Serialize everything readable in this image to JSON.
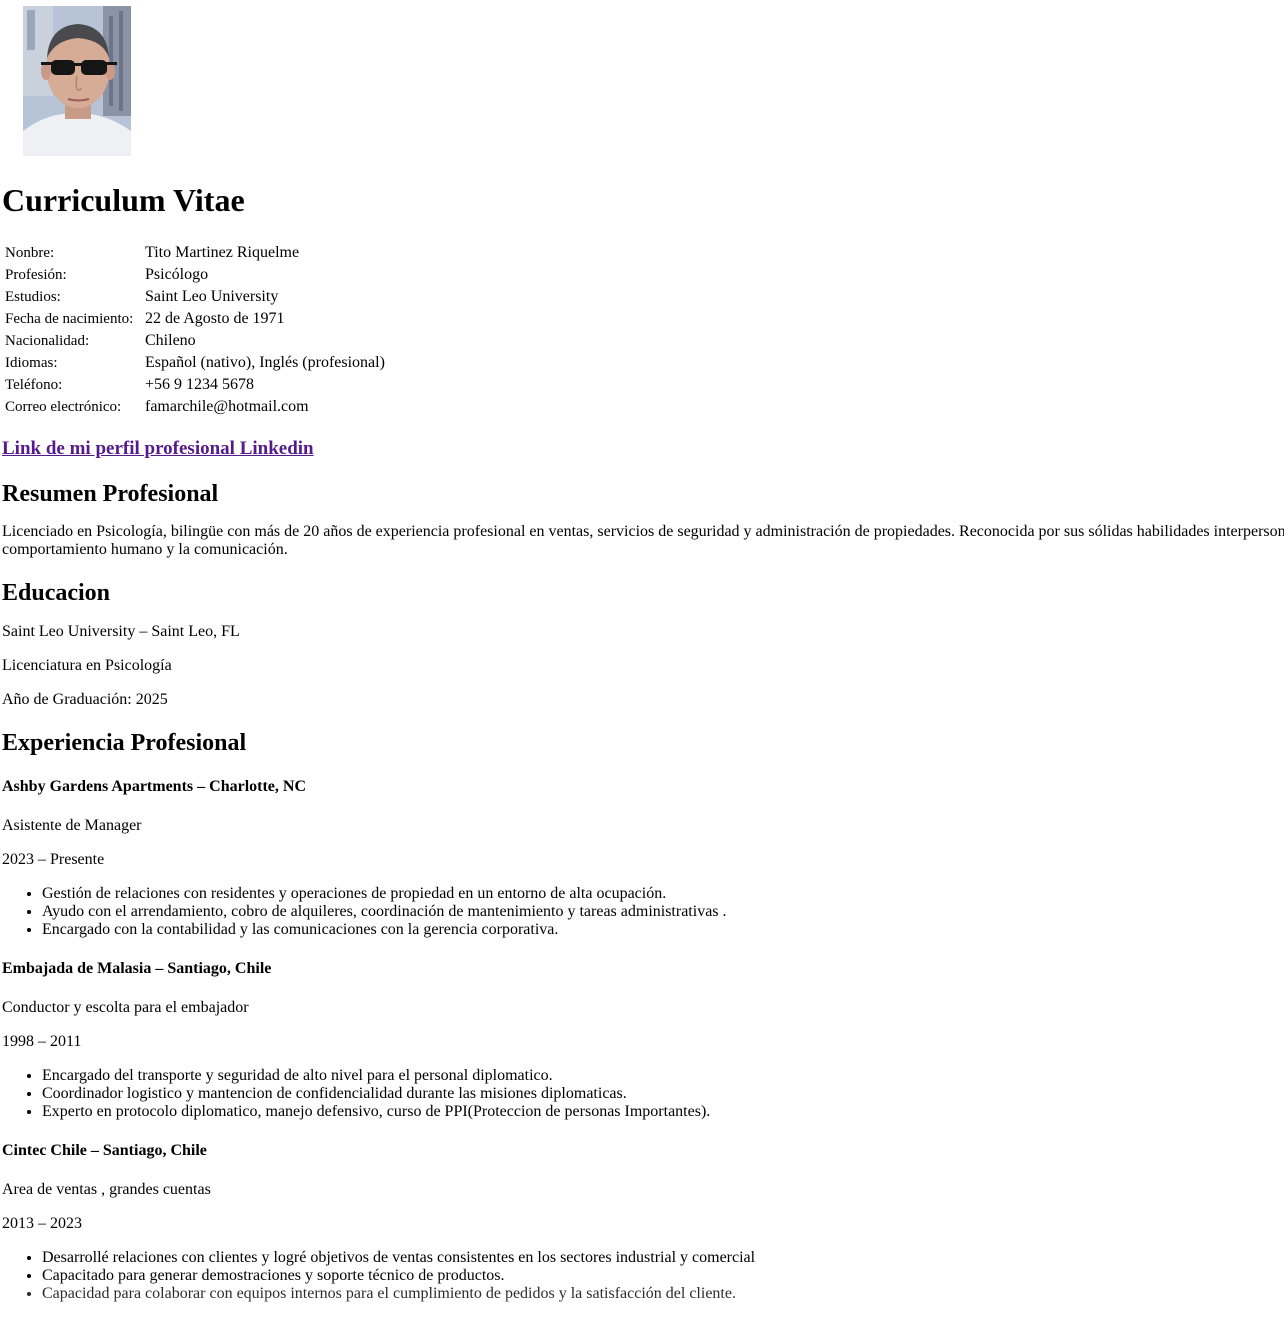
{
  "photo": {
    "icon": "profile-photo-man-sunglasses"
  },
  "title": "Curriculum Vitae",
  "info": [
    {
      "label": "Nonbre:",
      "value": "Tito Martinez Riquelme"
    },
    {
      "label": "Profesión:",
      "value": "Psicólogo"
    },
    {
      "label": "Estudios:",
      "value": "Saint Leo University"
    },
    {
      "label": "Fecha de nacimiento:",
      "value": "22 de Agosto de 1971"
    },
    {
      "label": "Nacionalidad:",
      "value": "Chileno"
    },
    {
      "label": "Idiomas:",
      "value": "Español (nativo), Inglés (profesional)"
    },
    {
      "label": "Teléfono:",
      "value": "+56 9 1234 5678"
    },
    {
      "label": "Correo electrónico:",
      "value": "famarchile@hotmail.com"
    }
  ],
  "linkedin": {
    "text": "Link de mi perfil profesional Linkedin",
    "color": "#551a8b"
  },
  "summary": {
    "heading": "Resumen Profesional",
    "text": "Licenciado en Psicología, bilingüe con más de 20 años de experiencia profesional en ventas, servicios de seguridad y administración de propiedades. Reconocida por sus sólidas habilidades interpersonales, comportamiento humano y la comunicación."
  },
  "education": {
    "heading": "Educacion",
    "school": "Saint Leo University – Saint Leo, FL",
    "degree": "Licenciatura en Psicología",
    "year": "Año de Graduación: 2025"
  },
  "experience": {
    "heading": "Experiencia Profesional",
    "jobs": [
      {
        "company": "Ashby Gardens Apartments – Charlotte, NC",
        "role": "Asistente de Manager",
        "period": "2023 – Presente",
        "bullets": [
          "Gestión de relaciones con residentes y operaciones de propiedad en un entorno de alta ocupación.",
          "Ayudo con el arrendamiento, cobro de alquileres, coordinación de mantenimiento y tareas administrativas .",
          "Encargado con la contabilidad y las comunicaciones con la gerencia corporativa."
        ]
      },
      {
        "company": "Embajada de Malasia – Santiago, Chile",
        "role": "Conductor y escolta para el embajador",
        "period": "1998 – 2011",
        "bullets": [
          "Encargado del transporte y seguridad de alto nivel para el personal diplomatico.",
          "Coordinador logistico y mantencion de confidencialidad durante las misiones diplomaticas.",
          "Experto en protocolo diplomatico, manejo defensivo, curso de PPI(Proteccion de personas Importantes)."
        ]
      },
      {
        "company": "Cintec Chile – Santiago, Chile",
        "role": "Area de ventas , grandes cuentas",
        "period": "2013 – 2023",
        "bullets": [
          "Desarrollé relaciones con clientes y logré objetivos de ventas consistentes en los sectores industrial y comercial",
          "Capacitado para generar demostraciones y soporte técnico de productos.",
          "Capacidad para colaborar con equipos internos para el cumplimiento de pedidos y la satisfacción del cliente."
        ]
      }
    ]
  }
}
